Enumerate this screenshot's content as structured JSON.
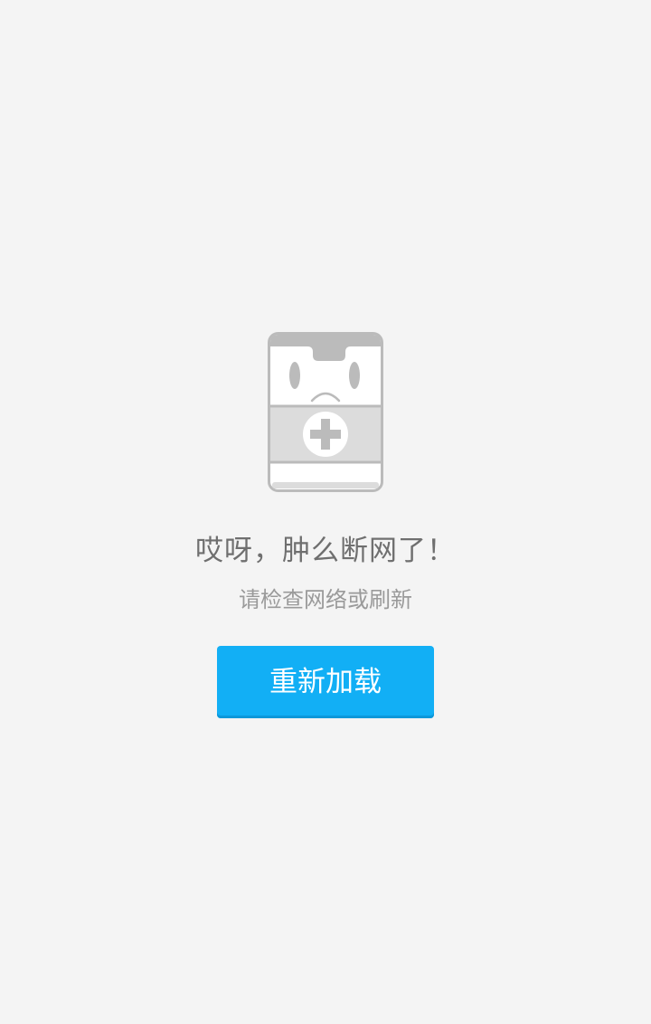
{
  "error_state": {
    "illustration_icon": "sad-first-aid-kit-icon",
    "title": "哎呀，肿么断网了！",
    "subtitle": "请检查网络或刷新",
    "reload_button_label": "重新加载"
  },
  "colors": {
    "background": "#f4f4f4",
    "title_text": "#6f6f6f",
    "subtitle_text": "#9a9a9a",
    "button_background": "#12aff5",
    "button_text": "#ffffff",
    "illustration_gray": "#bbbbbb"
  }
}
